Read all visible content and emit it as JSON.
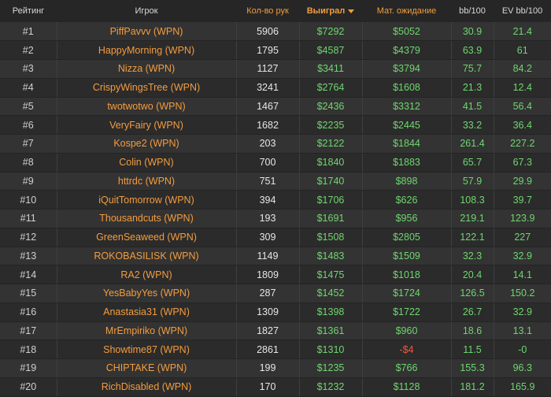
{
  "headers": {
    "rank": "Рейтинг",
    "player": "Игрок",
    "hands": "Кол-во рук",
    "won": "Выиграл",
    "ev": "Мат. ожидание",
    "bb100": "bb/100",
    "evbb100": "EV bb/100"
  },
  "colors": {
    "accent": "#f39c3e",
    "positive": "#6fd66f",
    "negative": "#f05a3c"
  },
  "rows": [
    {
      "rank": "#1",
      "player": "PiffPavvv (WPN)",
      "hands": "5906",
      "won": "$7292",
      "ev": "$5052",
      "bb100": "30.9",
      "evbb100": "21.4"
    },
    {
      "rank": "#2",
      "player": "HappyMorning (WPN)",
      "hands": "1795",
      "won": "$4587",
      "ev": "$4379",
      "bb100": "63.9",
      "evbb100": "61"
    },
    {
      "rank": "#3",
      "player": "Nizza (WPN)",
      "hands": "1127",
      "won": "$3411",
      "ev": "$3794",
      "bb100": "75.7",
      "evbb100": "84.2"
    },
    {
      "rank": "#4",
      "player": "CrispyWingsTree (WPN)",
      "hands": "3241",
      "won": "$2764",
      "ev": "$1608",
      "bb100": "21.3",
      "evbb100": "12.4"
    },
    {
      "rank": "#5",
      "player": "twotwotwo (WPN)",
      "hands": "1467",
      "won": "$2436",
      "ev": "$3312",
      "bb100": "41.5",
      "evbb100": "56.4"
    },
    {
      "rank": "#6",
      "player": "VeryFairy (WPN)",
      "hands": "1682",
      "won": "$2235",
      "ev": "$2445",
      "bb100": "33.2",
      "evbb100": "36.4"
    },
    {
      "rank": "#7",
      "player": "Kospe2 (WPN)",
      "hands": "203",
      "won": "$2122",
      "ev": "$1844",
      "bb100": "261.4",
      "evbb100": "227.2"
    },
    {
      "rank": "#8",
      "player": "Colin (WPN)",
      "hands": "700",
      "won": "$1840",
      "ev": "$1883",
      "bb100": "65.7",
      "evbb100": "67.3"
    },
    {
      "rank": "#9",
      "player": "httrdc (WPN)",
      "hands": "751",
      "won": "$1740",
      "ev": "$898",
      "bb100": "57.9",
      "evbb100": "29.9"
    },
    {
      "rank": "#10",
      "player": "iQuitTomorrow (WPN)",
      "hands": "394",
      "won": "$1706",
      "ev": "$626",
      "bb100": "108.3",
      "evbb100": "39.7"
    },
    {
      "rank": "#11",
      "player": "Thousandcuts (WPN)",
      "hands": "193",
      "won": "$1691",
      "ev": "$956",
      "bb100": "219.1",
      "evbb100": "123.9"
    },
    {
      "rank": "#12",
      "player": "GreenSeaweed (WPN)",
      "hands": "309",
      "won": "$1508",
      "ev": "$2805",
      "bb100": "122.1",
      "evbb100": "227"
    },
    {
      "rank": "#13",
      "player": "ROKOBASILISK (WPN)",
      "hands": "1149",
      "won": "$1483",
      "ev": "$1509",
      "bb100": "32.3",
      "evbb100": "32.9"
    },
    {
      "rank": "#14",
      "player": "RA2 (WPN)",
      "hands": "1809",
      "won": "$1475",
      "ev": "$1018",
      "bb100": "20.4",
      "evbb100": "14.1"
    },
    {
      "rank": "#15",
      "player": "YesBabyYes (WPN)",
      "hands": "287",
      "won": "$1452",
      "ev": "$1724",
      "bb100": "126.5",
      "evbb100": "150.2"
    },
    {
      "rank": "#16",
      "player": "Anastasia31 (WPN)",
      "hands": "1309",
      "won": "$1398",
      "ev": "$1722",
      "bb100": "26.7",
      "evbb100": "32.9"
    },
    {
      "rank": "#17",
      "player": "MrEmpiriko (WPN)",
      "hands": "1827",
      "won": "$1361",
      "ev": "$960",
      "bb100": "18.6",
      "evbb100": "13.1"
    },
    {
      "rank": "#18",
      "player": "Showtime87 (WPN)",
      "hands": "2861",
      "won": "$1310",
      "ev": "-$4",
      "bb100": "11.5",
      "evbb100": "-0"
    },
    {
      "rank": "#19",
      "player": "CHIPTAKE (WPN)",
      "hands": "199",
      "won": "$1235",
      "ev": "$766",
      "bb100": "155.3",
      "evbb100": "96.3"
    },
    {
      "rank": "#20",
      "player": "RichDisabled (WPN)",
      "hands": "170",
      "won": "$1232",
      "ev": "$1128",
      "bb100": "181.2",
      "evbb100": "165.9"
    }
  ]
}
